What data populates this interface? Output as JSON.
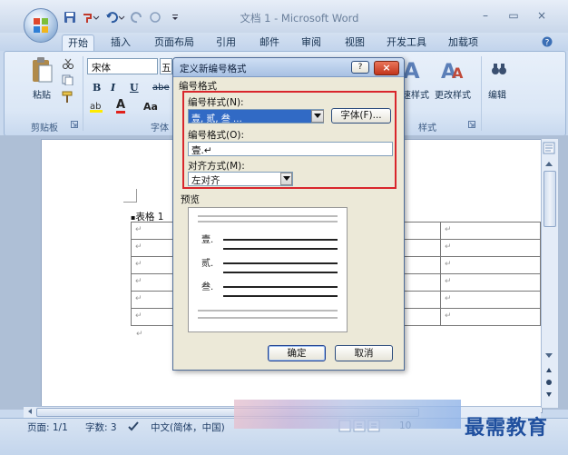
{
  "window": {
    "title": "文档 1 - Microsoft Word",
    "minimize": "–",
    "maximize": "▭",
    "close": "×"
  },
  "tabs": [
    "开始",
    "插入",
    "页面布局",
    "引用",
    "邮件",
    "审阅",
    "视图",
    "开发工具",
    "加载项"
  ],
  "ribbon": {
    "paste_label": "粘贴",
    "clipboard_group": "剪贴板",
    "font_name": "宋体",
    "font_size_partial": "五",
    "bold": "B",
    "italic": "I",
    "underline": "U",
    "strike": "abe",
    "font_group": "字体",
    "style_partial": "速样式",
    "change_style": "更改样式",
    "styles_group": "样式",
    "edit_label": "编辑",
    "font_color_glyph": "A",
    "case_glyph": "Aa"
  },
  "document": {
    "caption": "表格 1",
    "para_mark": "↵",
    "rows": 6
  },
  "dialog": {
    "title": "定义新编号格式",
    "help": "?",
    "close": "×",
    "section_label": "编号格式",
    "style_label": "编号样式(N):",
    "style_value": "壹, 贰, 叁 …",
    "font_button": "字体(F)...",
    "format_label": "编号格式(O):",
    "format_value": "壹.↵",
    "align_label": "对齐方式(M):",
    "align_value": "左对齐",
    "preview_label": "预览",
    "preview_items": [
      "壹.",
      "贰.",
      "叁."
    ],
    "ok": "确定",
    "cancel": "取消",
    "highlight_color": "#d9262c"
  },
  "status": {
    "page": "页面: 1/1",
    "words": "字数: 3",
    "language": "中文(简体，中国)",
    "zoom_partial": "10"
  },
  "watermark": "最需教育"
}
